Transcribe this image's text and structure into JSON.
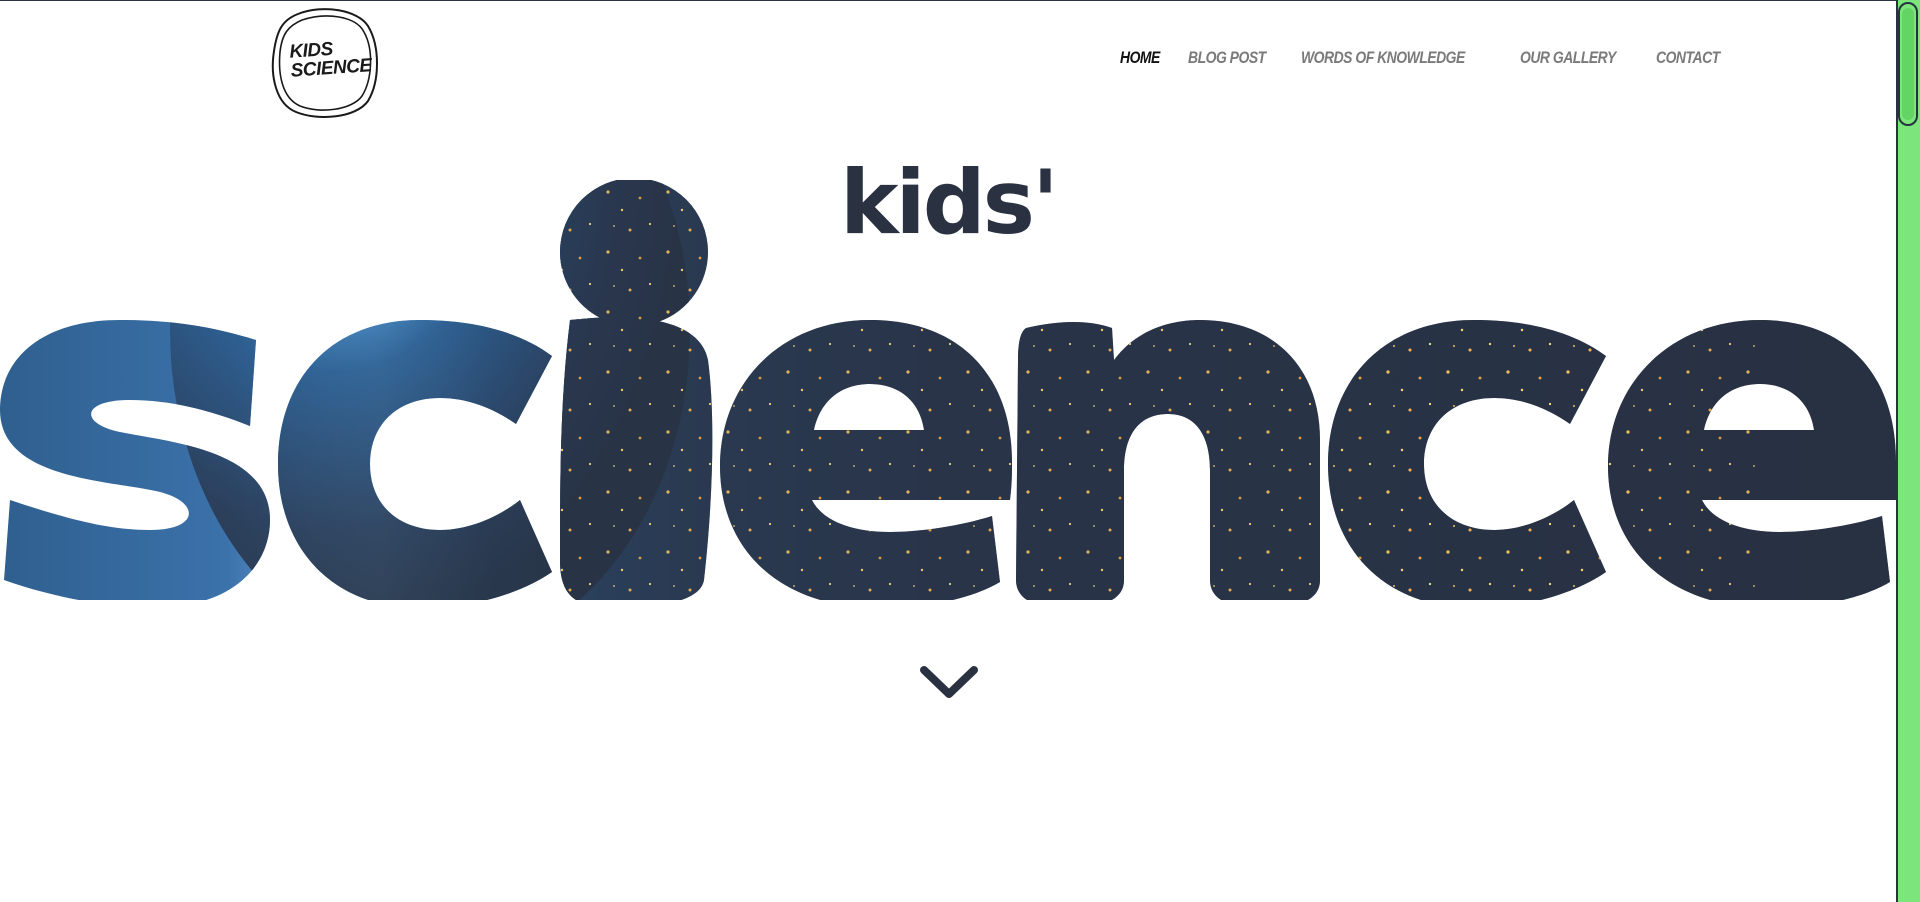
{
  "logo": {
    "line1": "KIDS",
    "line2": "SCIENCE"
  },
  "nav": {
    "items": [
      {
        "label": "Home",
        "active": true
      },
      {
        "label": "Blog Post",
        "active": false
      },
      {
        "label": "Words of Knowledge",
        "active": false
      },
      {
        "label": "Our Gallery",
        "active": false
      },
      {
        "label": "Contact",
        "active": false
      }
    ]
  },
  "hero": {
    "small_word": "kids'",
    "big_word": "science"
  },
  "icons": {
    "scroll_down": "chevron-down-icon"
  },
  "colors": {
    "text_dark": "#2a3141",
    "nav_inactive": "#7a7a7a",
    "nav_active": "#111111",
    "scrollbar": "#7ce67c"
  }
}
